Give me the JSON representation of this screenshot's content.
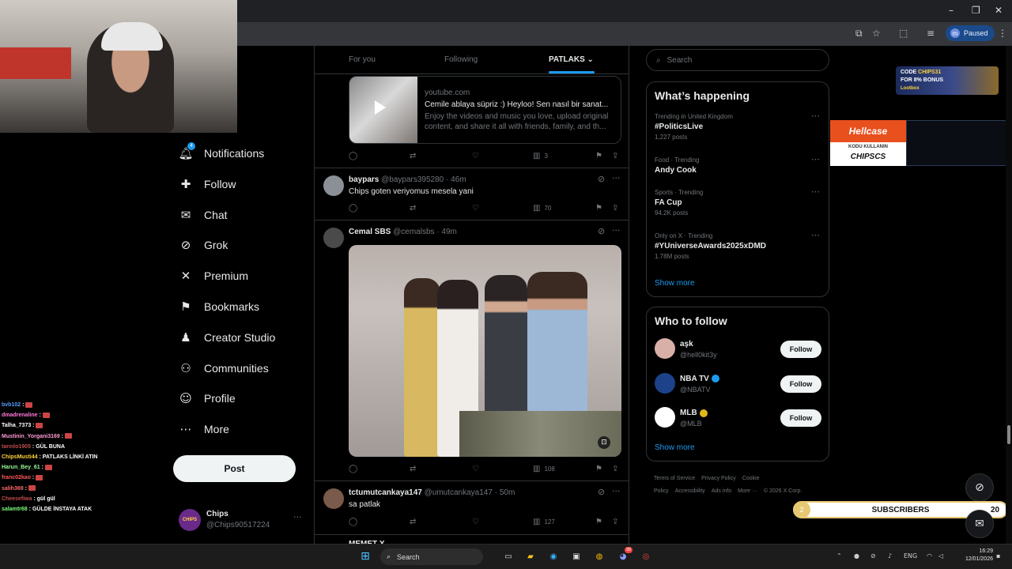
{
  "browser": {
    "paused_label": "Paused",
    "profile_initial": "m"
  },
  "chat": [
    {
      "user": "bvb102",
      "color": "#5a9cff",
      "text": ""
    },
    {
      "user": "dmadrenaline",
      "color": "#ff7ad9",
      "text": ""
    },
    {
      "user": "Talha_7373",
      "color": "#ffffff",
      "text": ""
    },
    {
      "user": "Mustinin_Yorgani3169",
      "color": "#ff9bd4",
      "text": ""
    },
    {
      "user": "tarınlo1905",
      "color": "#c04b4b",
      "text": "GÜL BUNA"
    },
    {
      "user": "ChipsMusti44",
      "color": "#ffd23c",
      "text": "PATLAKS LİNKİ ATIN"
    },
    {
      "user": "Harun_Bey_61",
      "color": "#9bff9b",
      "text": ""
    },
    {
      "user": "franc02kao",
      "color": "#ff5a5a",
      "text": ""
    },
    {
      "user": "salih369",
      "color": "#ff6a6a",
      "text": ""
    },
    {
      "user": "Cheesefiwa",
      "color": "#c04b4b",
      "text": "gül gül"
    },
    {
      "user": "salamtr68",
      "color": "#7cff7c",
      "text": "GÜLDE İNSTAYA ATAK"
    }
  ],
  "nav": {
    "items": [
      {
        "label": "Notifications",
        "icon": "bell-icon"
      },
      {
        "label": "Follow",
        "icon": "person-add-icon"
      },
      {
        "label": "Chat",
        "icon": "mail-icon"
      },
      {
        "label": "Grok",
        "icon": "grok-icon"
      },
      {
        "label": "Premium",
        "icon": "x-logo-icon"
      },
      {
        "label": "Bookmarks",
        "icon": "bookmark-icon"
      },
      {
        "label": "Creator Studio",
        "icon": "creator-studio-icon"
      },
      {
        "label": "Communities",
        "icon": "communities-icon"
      },
      {
        "label": "Profile",
        "icon": "profile-icon"
      },
      {
        "label": "More",
        "icon": "more-circle-icon"
      }
    ],
    "notification_badge": "4",
    "post_label": "Post",
    "account": {
      "name": "Chips",
      "handle": "@Chips90517224",
      "avatar_text": "CHIPS"
    }
  },
  "timeline": {
    "tabs": [
      "For you",
      "Following",
      "PATLAKS"
    ],
    "card": {
      "domain": "youtube.com",
      "title": "Cemile ablaya süpriz :) Heyloo! Sen nasıl bir sanat...",
      "desc": "Enjoy the videos and music you love, upload original content, and share it all with friends, family, and th..."
    },
    "card_actions": {
      "views": "3"
    },
    "tweets": [
      {
        "name": "baypars",
        "handle": "@baypars395280",
        "time": "· 46m",
        "text": "Chips goten veriyomus mesela yani",
        "views": "70"
      },
      {
        "name": "Cemal SBS",
        "handle": "@cemalsbs",
        "time": "· 49m",
        "text": "",
        "views": "108"
      },
      {
        "name": "tctumutcankaya147",
        "handle": "@umutcankaya147",
        "time": "· 50m",
        "text": "sa patlak",
        "views": "127"
      }
    ],
    "next_partial": "MEMET X"
  },
  "sidebar": {
    "search_placeholder": "Search",
    "happening": {
      "title": "What’s happening",
      "trends": [
        {
          "meta": "Trending in United Kingdom",
          "name": "#PoliticsLive",
          "count": "1,227 posts"
        },
        {
          "meta": "Food · Trending",
          "name": "Andy Cook",
          "count": ""
        },
        {
          "meta": "Sports · Trending",
          "name": "FA Cup",
          "count": "94.2K posts"
        },
        {
          "meta": "Only on X · Trending",
          "name": "#YUniverseAwards2025xDMD",
          "count": "1.78M posts"
        }
      ],
      "show_more": "Show more"
    },
    "who_to_follow": {
      "title": "Who to follow",
      "accounts": [
        {
          "name": "aşk",
          "handle": "@hell0kit3y",
          "verified": "",
          "avatar_color": "#d8b0a8"
        },
        {
          "name": "NBA TV",
          "handle": "@NBATV",
          "verified": "#1d9bf0",
          "avatar_color": "#1d428a"
        },
        {
          "name": "MLB",
          "handle": "@MLB",
          "verified": "#e2b719",
          "avatar_color": "#ffffff"
        }
      ],
      "follow_label": "Follow",
      "show_more": "Show more"
    },
    "footer": [
      "Terms of Service",
      "Privacy Policy",
      "Cookie Policy",
      "Accessibility",
      "Ads info",
      "More ···",
      "© 2026 X Corp."
    ]
  },
  "overlays": {
    "code_ad": {
      "line1a": "CODE ",
      "line1b": "CHIPS31",
      "line2": "FOR 8% BONUS",
      "line3": "Lootbox"
    },
    "hellcase": {
      "brand": "Hellcase",
      "line1": "KODU KULLANIN",
      "line2": "CHIPSCS"
    },
    "subs": {
      "count_left": "2",
      "label": "SUBSCRIBERS",
      "count_right": "20"
    }
  },
  "taskbar": {
    "search": "Search",
    "lang": "ENG",
    "time": "16:29",
    "date": "12/01/2026",
    "discord_badge": "99"
  }
}
